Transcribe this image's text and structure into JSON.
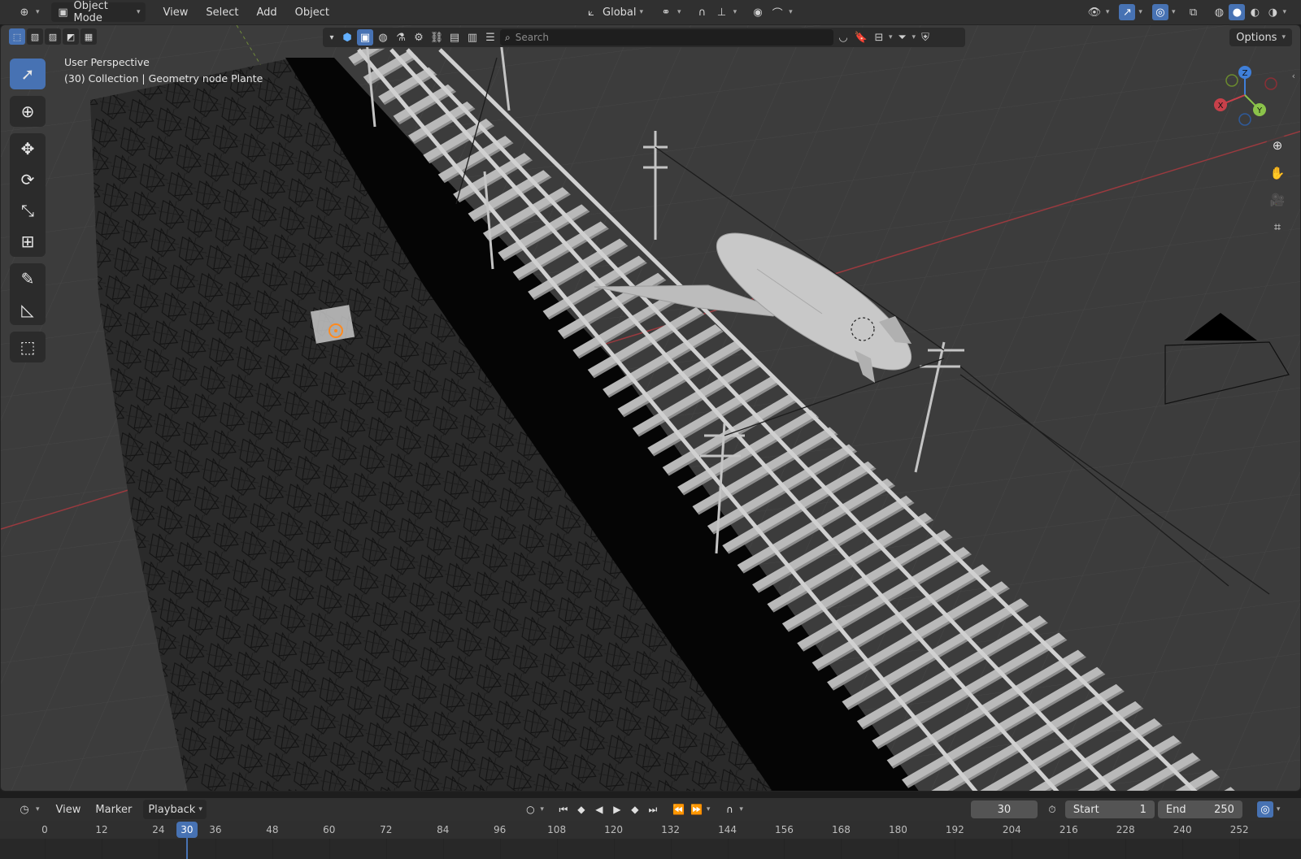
{
  "header": {
    "editor_type_icon": "globe-grid-icon",
    "mode_label": "Object Mode",
    "menus": [
      "View",
      "Select",
      "Add",
      "Object"
    ],
    "transform_orientation": "Global"
  },
  "filter_bar": {
    "search_placeholder": "Search"
  },
  "options_label": "Options",
  "viewport": {
    "view_name": "User Perspective",
    "collection_info": "(30) Collection | Geometry node Plante"
  },
  "gizmo": {
    "x": "X",
    "y": "Y",
    "z": "Z"
  },
  "toolbar": [
    {
      "name": "select-box-tool",
      "icon": "select-cursor-icon",
      "glyph": "➚",
      "active": true
    },
    {
      "name": "cursor-tool",
      "icon": "crosshair-icon",
      "glyph": "⊕",
      "active": false
    },
    {
      "name": "move-tool",
      "icon": "move-arrows-icon",
      "glyph": "✥",
      "active": false
    },
    {
      "name": "rotate-tool",
      "icon": "rotate-icon",
      "glyph": "⟳",
      "active": false
    },
    {
      "name": "scale-tool",
      "icon": "scale-icon",
      "glyph": "⤡",
      "active": false
    },
    {
      "name": "transform-tool",
      "icon": "transform-icon",
      "glyph": "⊞",
      "active": false
    },
    {
      "name": "annotate-tool",
      "icon": "pencil-icon",
      "glyph": "✎",
      "active": false
    },
    {
      "name": "measure-tool",
      "icon": "ruler-icon",
      "glyph": "📐",
      "active": false
    },
    {
      "name": "add-cube-tool",
      "icon": "add-cube-icon",
      "glyph": "⬚",
      "active": false
    }
  ],
  "timeline": {
    "menus": [
      "View",
      "Marker",
      "Playback"
    ],
    "current_frame": "30",
    "start_label": "Start",
    "start_value": "1",
    "end_label": "End",
    "end_value": "250",
    "ticks": [
      "0",
      "12",
      "24",
      "30",
      "36",
      "48",
      "60",
      "72",
      "84",
      "96",
      "108",
      "120",
      "132",
      "144",
      "156",
      "168",
      "180",
      "192",
      "204",
      "216",
      "228",
      "240",
      "252"
    ]
  },
  "colors": {
    "accent": "#4772b3",
    "axis_x": "#c8404a",
    "axis_y": "#8bc34a",
    "axis_z": "#3f7fd9",
    "viewport_bg": "#3c3c3c"
  }
}
